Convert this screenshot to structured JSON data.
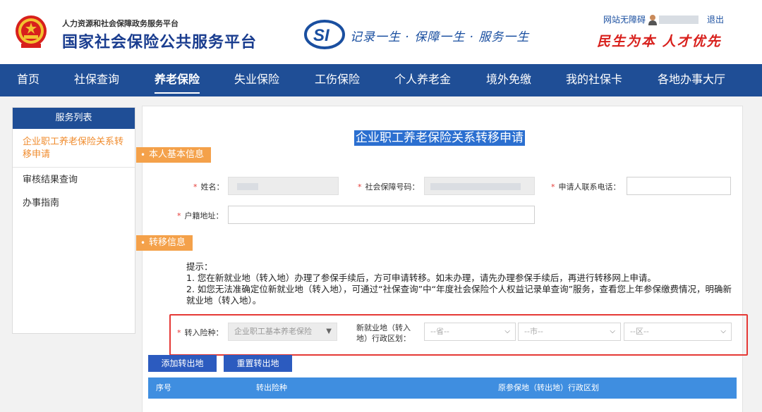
{
  "header": {
    "subtitle": "人力资源和社会保障政务服务平台",
    "title": "国家社会保险公共服务平台",
    "slogan": "记录一生 · 保障一生 · 服务一生",
    "accessibility_link": "网站无障碍",
    "logout_link": "退出",
    "motto": "民生为本 人才优先",
    "colors": {
      "brand_blue": "#1f4e96",
      "motto_red": "#d8201c"
    }
  },
  "nav": {
    "items": [
      "首页",
      "社保查询",
      "养老保险",
      "失业保险",
      "工伤保险",
      "个人养老金",
      "境外免缴",
      "我的社保卡",
      "各地办事大厅"
    ],
    "active": "养老保险"
  },
  "sidebar": {
    "title": "服务列表",
    "items": [
      "企业职工养老保险关系转移申请",
      "审核结果查询",
      "办事指南"
    ]
  },
  "form": {
    "title": "企业职工养老保险关系转移申请",
    "section_basic": "本人基本信息",
    "name_label": "姓名：",
    "ssn_label": "社会保障号码：",
    "phone_label": "申请人联系电话：",
    "address_label": "户籍地址：",
    "required_mark": "*",
    "section_transfer": "转移信息",
    "tips_title": "提示：",
    "tip1": "1. 您在新就业地（转入地）办理了参保手续后，方可申请转移。如未办理，请先办理参保手续后，再进行转移网上申请。",
    "tip2": "2. 如您无法准确定位新就业地（转入地），可通过“社保查询”中“年度社会保险个人权益记录单查询”服务，查看您上年参保缴费情况，明确新就业地（转入地）。",
    "insurance_label": "转入险种：",
    "insurance_value": "企业职工基本养老保险",
    "region_label_1": "新就业地（转入",
    "region_label_2": "地）行政区划：",
    "province_placeholder": "--省--",
    "city_placeholder": "--市--",
    "district_placeholder": "--区--",
    "add_button": "添加转出地",
    "reset_button": "重置转出地",
    "table_columns": [
      "序号",
      "转出险种",
      "原参保地（转出地）行政区划"
    ]
  }
}
